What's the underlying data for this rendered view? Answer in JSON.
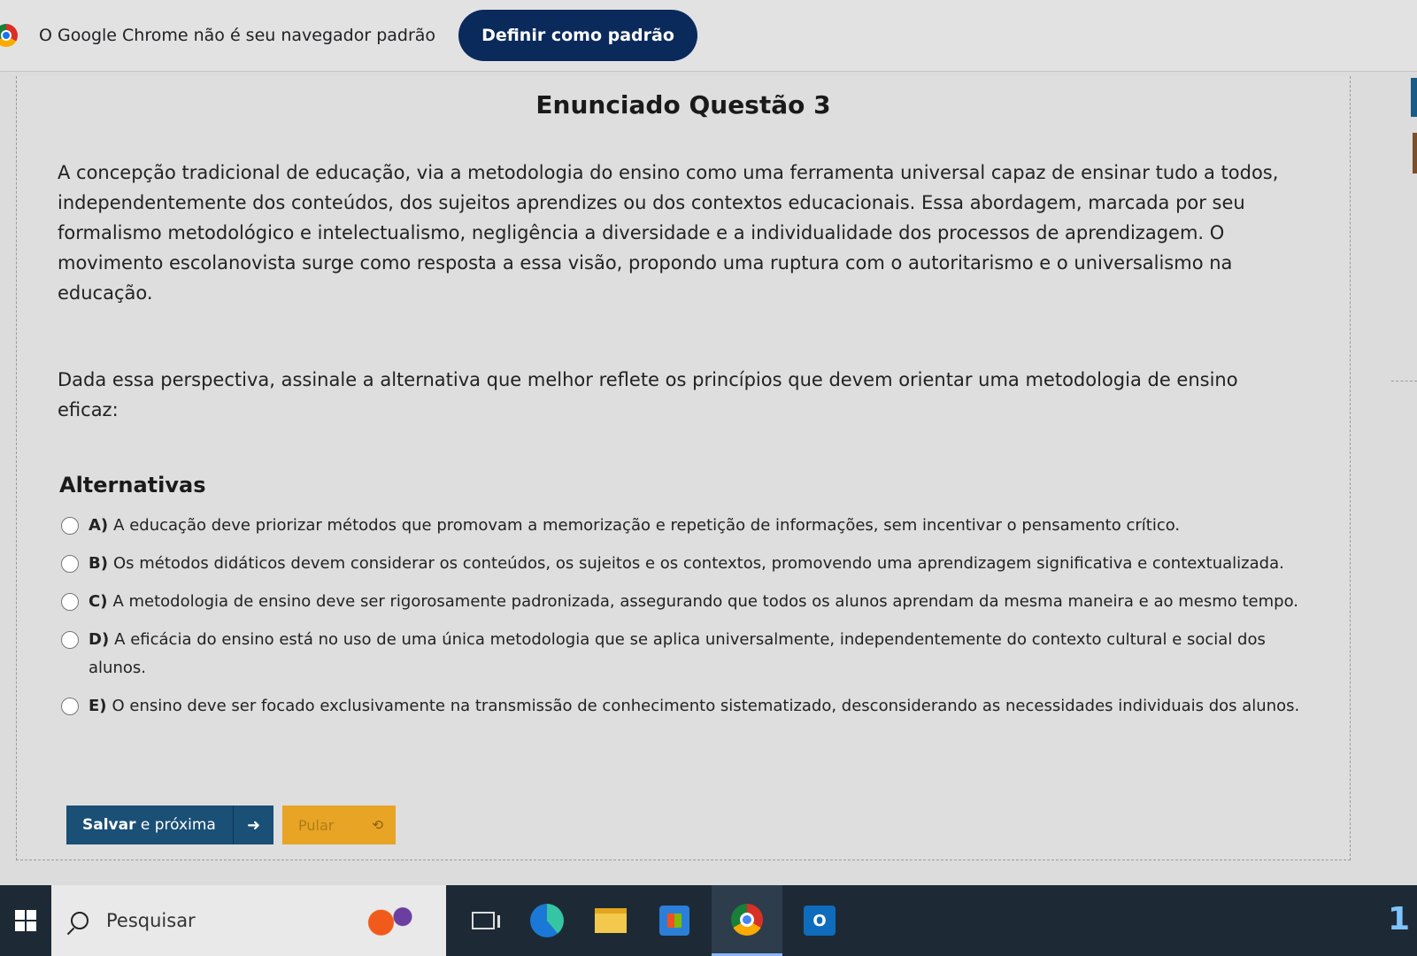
{
  "infobar": {
    "message": "O Google Chrome não é seu navegador padrão",
    "set_default_label": "Definir como padrão"
  },
  "question": {
    "title": "Enunciado Questão 3",
    "paragraph1": "A concepção tradicional de educação, via a metodologia do ensino como uma ferramenta universal capaz de ensinar tudo a todos, independentemente dos conteúdos, dos sujeitos aprendizes ou dos contextos educacionais. Essa abordagem, marcada por seu formalismo metodológico e intelectualismo, negligência a diversidade e a individualidade dos processos de aprendizagem. O movimento escolanovista surge como resposta a essa visão, propondo uma ruptura com o autoritarismo e o universalismo na educação.",
    "paragraph2": "Dada essa perspectiva, assinale a alternativa que melhor reflete os princípios que devem orientar uma metodologia de ensino eficaz:"
  },
  "alternatives": {
    "title": "Alternativas",
    "items": [
      {
        "letter": "A)",
        "text": "A educação deve priorizar métodos que promovam a memorização e repetição de informações, sem incentivar o pensamento crítico."
      },
      {
        "letter": "B)",
        "text": "Os métodos didáticos devem considerar os conteúdos, os sujeitos e os contextos, promovendo uma aprendizagem significativa e contextualizada."
      },
      {
        "letter": "C)",
        "text": "A metodologia de ensino deve ser rigorosamente padronizada, assegurando que todos os alunos aprendam da mesma maneira e ao mesmo tempo."
      },
      {
        "letter": "D)",
        "text": "A eficácia do ensino está no uso de uma única metodologia que se aplica universalmente, independentemente do contexto cultural e social dos alunos."
      },
      {
        "letter": "E)",
        "text": "O ensino deve ser focado exclusivamente na transmissão de conhecimento sistematizado, desconsiderando as necessidades individuais dos alunos."
      }
    ]
  },
  "actions": {
    "save_bold": "Salvar",
    "save_rest": " e próxima",
    "skip_label": "Pular"
  },
  "taskbar": {
    "search_placeholder": "Pesquisar",
    "tray_text": "1",
    "outlook_letter": "O"
  },
  "colors": {
    "set_default_button": "#0b2a5c",
    "save_button": "#1a4f76",
    "skip_button": "#e7a425",
    "taskbar": "#1d2a36"
  }
}
